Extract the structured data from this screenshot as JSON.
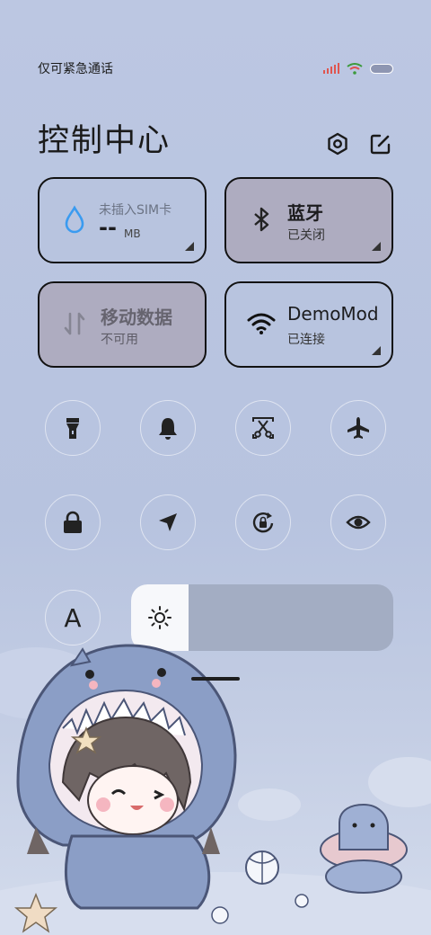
{
  "status_bar": {
    "carrier": "仅可紧急通话",
    "battery_fill_fraction": 0.1
  },
  "header": {
    "title": "控制中心",
    "settings_icon": "settings-hexagon-icon",
    "edit_icon": "edit-icon"
  },
  "tiles": [
    {
      "key": "data",
      "title": "未插入SIM卡",
      "value": "--",
      "unit": "MB",
      "icon": "water-drop-icon",
      "color": "#3a9bf0"
    },
    {
      "key": "bluetooth",
      "title": "蓝牙",
      "status": "已关闭",
      "icon": "bluetooth-icon"
    },
    {
      "key": "mobile_data",
      "title": "移动数据",
      "status": "不可用",
      "icon": "data-transfer-icon"
    },
    {
      "key": "wifi",
      "title": "DemoMod",
      "status": "已连接",
      "icon": "wifi-icon"
    }
  ],
  "toggles": [
    {
      "name": "flashlight",
      "icon": "flashlight-icon"
    },
    {
      "name": "ringer",
      "icon": "bell-icon"
    },
    {
      "name": "screenshot",
      "icon": "scissors-icon"
    },
    {
      "name": "airplane",
      "icon": "airplane-icon"
    },
    {
      "name": "lock",
      "icon": "lock-icon"
    },
    {
      "name": "location",
      "icon": "location-arrow-icon"
    },
    {
      "name": "rotation-lock",
      "icon": "rotation-lock-icon"
    },
    {
      "name": "eye-comfort",
      "icon": "eye-icon"
    }
  ],
  "text_size": {
    "label": "A"
  },
  "brightness": {
    "icon": "sun-icon",
    "level_fraction": 0.22
  }
}
